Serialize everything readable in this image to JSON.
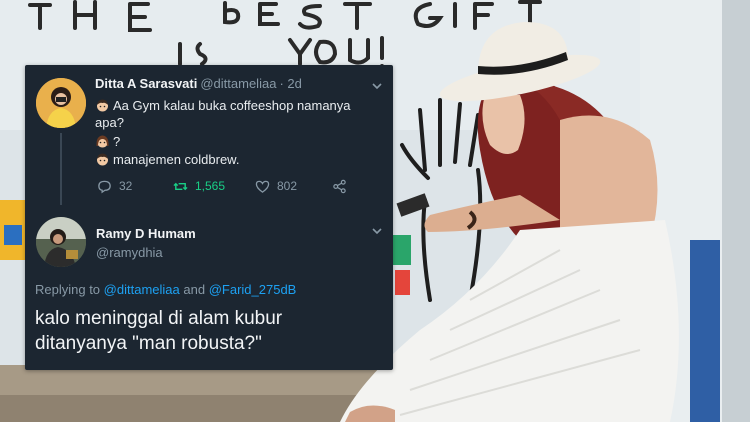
{
  "background": {
    "wall_text": [
      "THE",
      "BEST",
      "GIFT",
      "IS",
      "YOU!"
    ],
    "colors": {
      "wall": "#dfe6ea",
      "ground": "#a79a86",
      "dress": "#f3f3f1",
      "hair": "#7e2220",
      "hat": "#f1ede4"
    }
  },
  "tweet": {
    "author_name": "Ditta A Sarasvati",
    "author_handle": "@dittameliaa",
    "time": "· 2d",
    "lines": [
      "Aa Gym kalau buka coffeeshop namanya",
      "apa?",
      "?",
      "manajemen coldbrew."
    ],
    "reply_count": "32",
    "retweet_count": "1,565",
    "like_count": "802"
  },
  "reply": {
    "author_name": "Ramy D Humam",
    "author_handle": "@ramydhia",
    "replying_prefix": "Replying to",
    "mention_1": "@dittameliaa",
    "and_word": "and",
    "mention_2": "@Farid_275dB",
    "text_line_1": "kalo meninggal di alam kubur",
    "text_line_2": "ditanyanya \"man robusta?\""
  },
  "colors": {
    "card": "#1c2631",
    "secondary_text": "#8899a6",
    "retweet_green": "#19cf86",
    "link_blue": "#1da1f2"
  },
  "icons": [
    "reply-icon",
    "retweet-icon",
    "like-icon",
    "share-icon",
    "chevron-down-icon",
    "boy-emoji-icon",
    "girl-emoji-icon"
  ]
}
